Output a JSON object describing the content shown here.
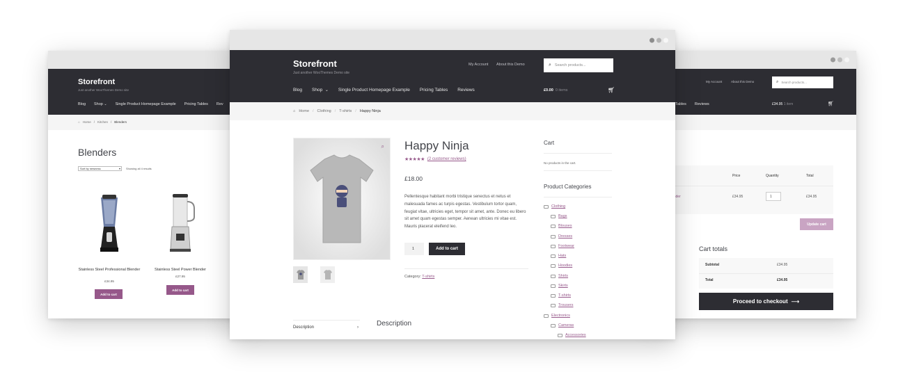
{
  "brand": {
    "accent": "#96588a",
    "header_bg": "#2d2d33",
    "dark_button": "#2d2d33"
  },
  "left": {
    "logo": "Storefront",
    "tagline": "Just another WooThemes Demo site",
    "nav": [
      "Blog",
      "Shop",
      "Single Product Homepage Example",
      "Pricing Tables",
      "Rev"
    ],
    "breadcrumb": [
      "Home",
      "Kitchen",
      "Blenders"
    ],
    "page_title": "Blenders",
    "sort_value": "Sort by newness",
    "result_count": "Showing all 4 results",
    "products": [
      {
        "name": "Stainless Steel Professional Blender",
        "price": "£34.95",
        "button": "Add to cart"
      },
      {
        "name": "Stainless Steel Power Blender",
        "price": "£27.95",
        "button": "Add to cart"
      }
    ]
  },
  "main": {
    "logo": "Storefront",
    "tagline": "Just another WooThemes Demo site",
    "top_links": [
      "My Account",
      "About this Demo"
    ],
    "search_placeholder": "Search products...",
    "nav": [
      "Blog",
      "Shop",
      "Single Product Homepage Example",
      "Pricing Tables",
      "Reviews"
    ],
    "cart_total": "£0.00",
    "cart_items": "0 items",
    "breadcrumb": [
      "Home",
      "Clothing",
      "T-shirts",
      "Happy Ninja"
    ],
    "product": {
      "title": "Happy Ninja",
      "stars": "★★★★★",
      "rating": 5,
      "reviews": "(2 customer reviews)",
      "price": "£18.00",
      "description": "Pellentesque habitant morbi tristique senectus et netus et malesuada fames ac turpis egestas. Vestibulum tortor quam, feugiat vitae, ultricies eget, tempor sit amet, ante. Donec eu libero sit amet quam egestas semper. Aenean ultricies mi vitae est. Mauris placerat eleifend leo.",
      "quantity": "1",
      "add_button": "Add to cart",
      "category_label": "Category:",
      "category": "T-shirts"
    },
    "tabs": {
      "description_tab": "Description",
      "description_heading": "Description"
    },
    "sidebar": {
      "cart_title": "Cart",
      "cart_empty": "No products in the cart.",
      "categories_title": "Product Categories",
      "categories": [
        "Clothing",
        "Bags",
        "Blouses",
        "Dresses",
        "Footwear",
        "Hats",
        "Hoodies",
        "Shirts",
        "Skirts",
        "T-shirts",
        "Trousers",
        "Electronics",
        "Cameras",
        "Accessories"
      ]
    }
  },
  "right": {
    "top_links": [
      "My Account",
      "About this Demo"
    ],
    "search_placeholder": "Search products...",
    "nav": [
      "Tables",
      "Reviews"
    ],
    "cart_total": "£34.95",
    "cart_items": "1 item",
    "table_headers": [
      "Price",
      "Quantity",
      "Total"
    ],
    "row": {
      "product": "l Blender",
      "price": "£34.95",
      "qty": "1",
      "total": "£34.95"
    },
    "update_button": "Update cart",
    "totals_title": "Cart totals",
    "subtotal_label": "Subtotal",
    "subtotal_value": "£34.95",
    "total_label": "Total",
    "total_value": "£34.95",
    "checkout_button": "Proceed to checkout"
  }
}
